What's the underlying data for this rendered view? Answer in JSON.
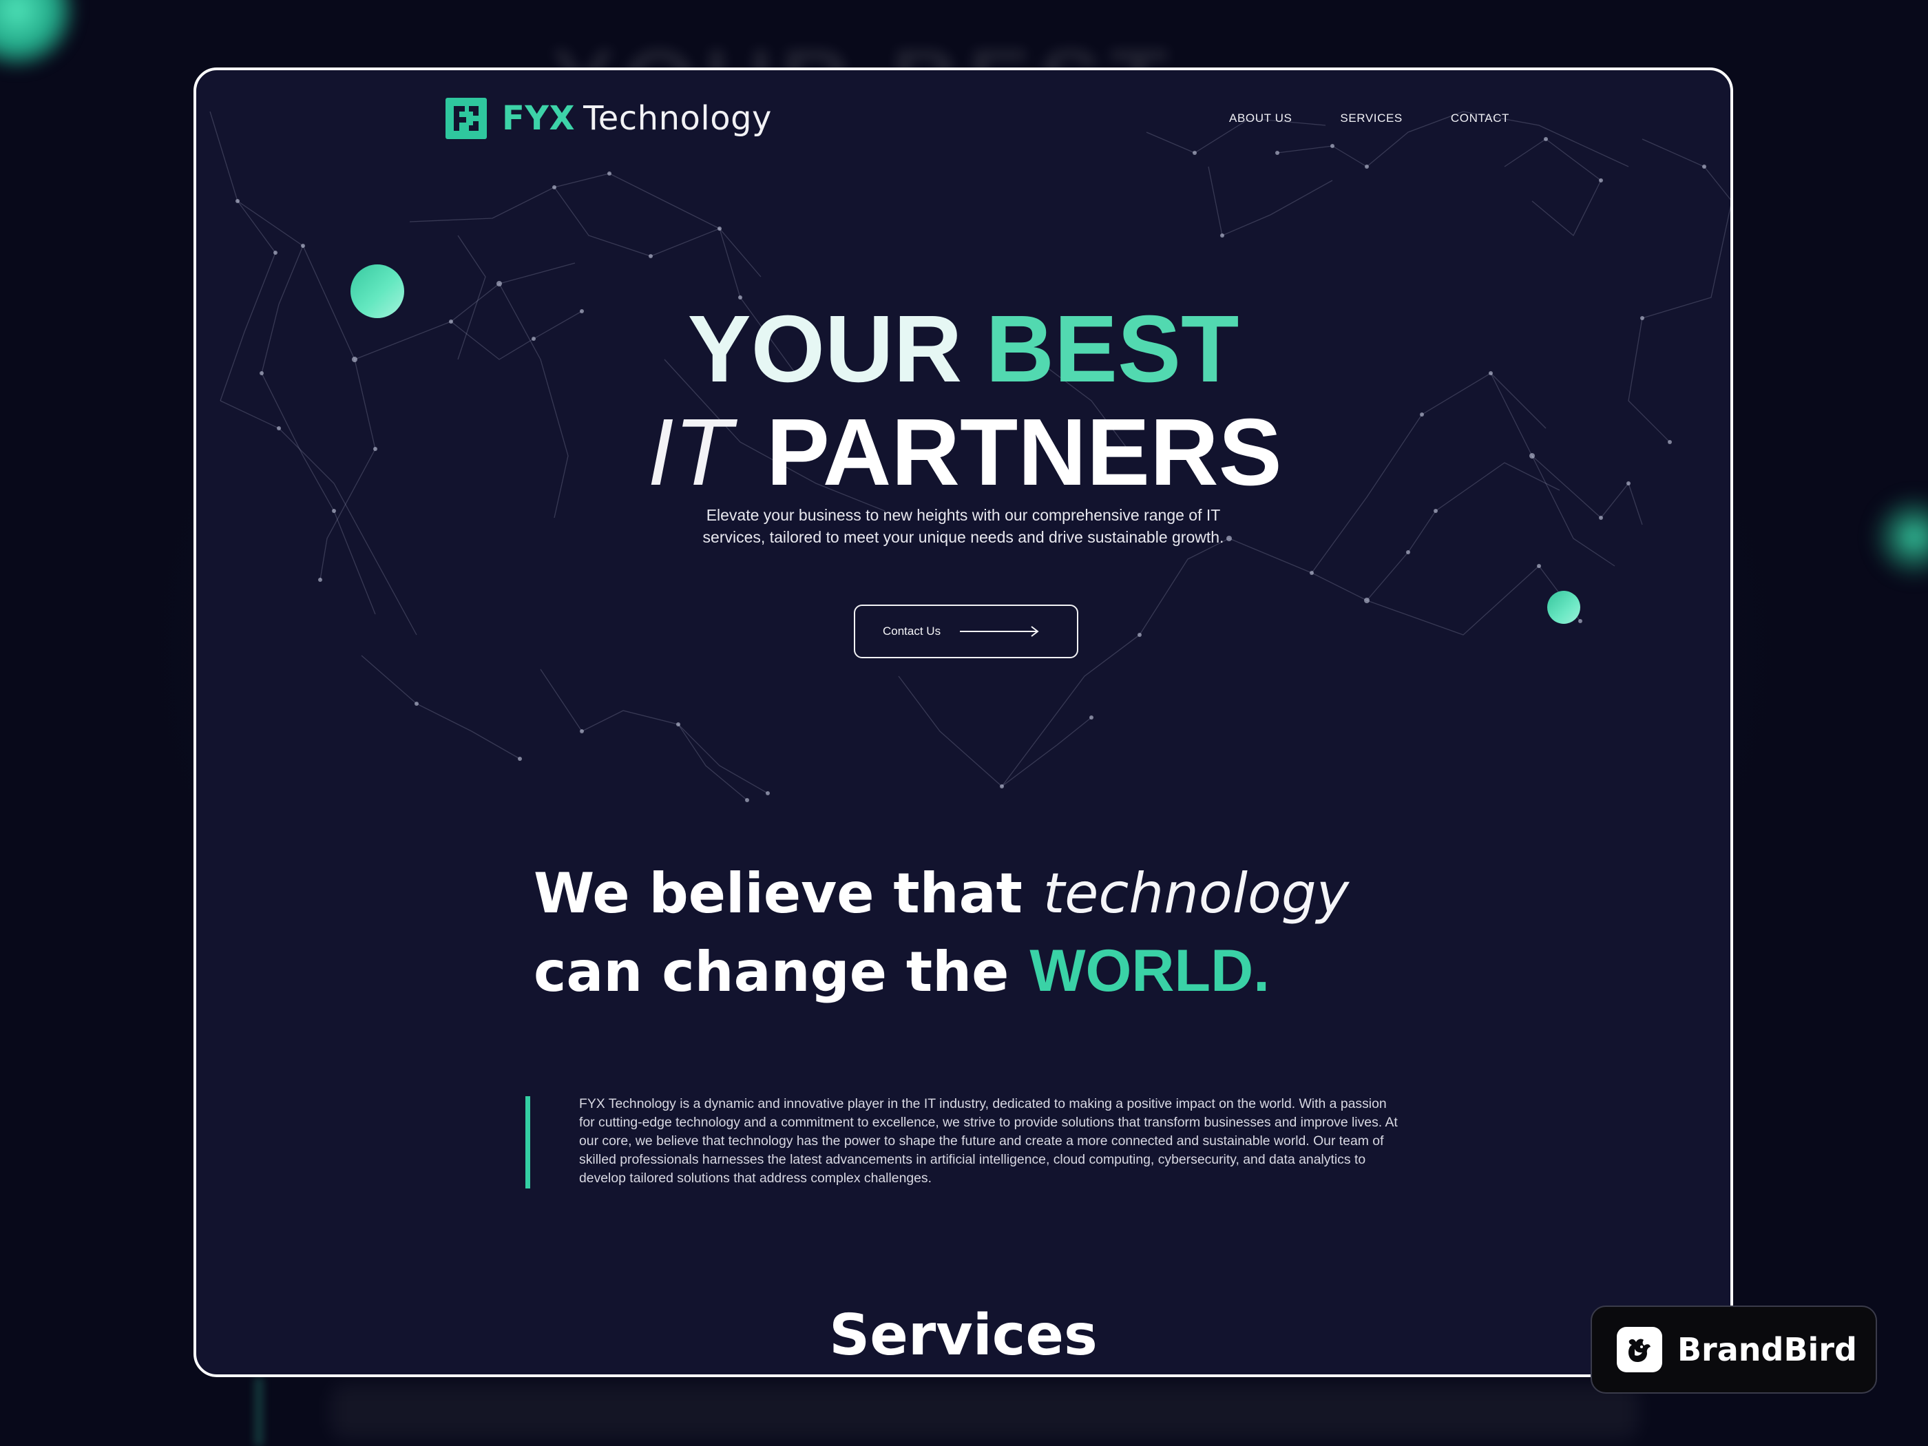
{
  "brand": {
    "name_accent": "FYX",
    "name_rest": "Technology",
    "accent_color": "#3dd3a8"
  },
  "nav": {
    "items": [
      {
        "label": "ABOUT US"
      },
      {
        "label": "SERVICES"
      },
      {
        "label": "CONTACT"
      }
    ]
  },
  "hero": {
    "line1_a": "YOUR",
    "line1_b": "BEST",
    "line2_a": "IT",
    "line2_b": "PARTNERS",
    "subtitle_1": "Elevate your business to new heights with our comprehensive range of IT",
    "subtitle_2": "services, tailored to meet your unique needs and drive sustainable growth.",
    "cta_label": "Contact Us",
    "cta_icon": "arrow-right-icon"
  },
  "belief": {
    "line1_a": "We believe that",
    "line1_b": "technology",
    "line2_a": "can change the",
    "line2_b": "WORLD."
  },
  "about": {
    "text": "FYX Technology is a dynamic and innovative player in the IT industry, dedicated to making a positive impact on the world. With a passion for cutting-edge technology and a commitment to excellence, we strive to provide solutions that transform businesses and improve lives. At our core, we believe that technology has the power to shape the future and create a more connected and sustainable world. Our team of skilled professionals harnesses the latest advancements in artificial intelligence, cloud computing, cybersecurity, and data analytics to develop tailored solutions that address complex challenges."
  },
  "services": {
    "heading": "Services"
  },
  "badge": {
    "label": "BrandBird",
    "icon": "brandbird-logo-icon"
  },
  "colors": {
    "background": "#12132e",
    "accent": "#3ad2a6",
    "frame_border": "#ffffff"
  }
}
